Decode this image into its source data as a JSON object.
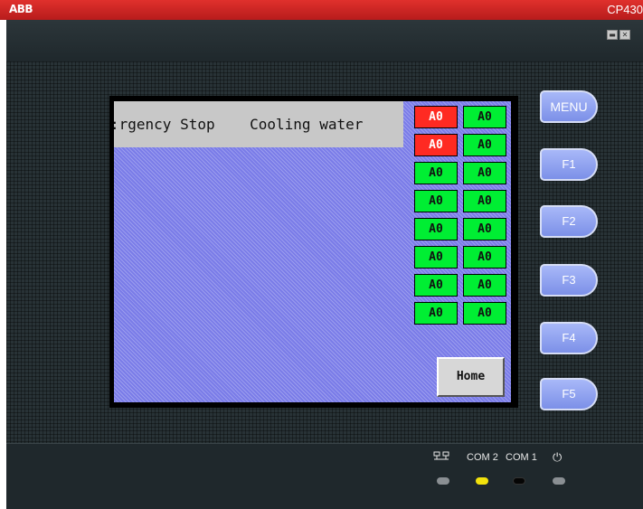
{
  "window": {
    "brand": "ABB",
    "model": "CP430",
    "minimize_symbol": "▬",
    "close_symbol": "✕"
  },
  "screen": {
    "alarm_banner": ":rgency Stop    Cooling water",
    "indicators": [
      {
        "label": "A0",
        "state": "alarm"
      },
      {
        "label": "A0",
        "state": "normal"
      },
      {
        "label": "A0",
        "state": "alarm"
      },
      {
        "label": "A0",
        "state": "normal"
      },
      {
        "label": "A0",
        "state": "normal"
      },
      {
        "label": "A0",
        "state": "normal"
      },
      {
        "label": "A0",
        "state": "normal"
      },
      {
        "label": "A0",
        "state": "normal"
      },
      {
        "label": "A0",
        "state": "normal"
      },
      {
        "label": "A0",
        "state": "normal"
      },
      {
        "label": "A0",
        "state": "normal"
      },
      {
        "label": "A0",
        "state": "normal"
      },
      {
        "label": "A0",
        "state": "normal"
      },
      {
        "label": "A0",
        "state": "normal"
      },
      {
        "label": "A0",
        "state": "normal"
      },
      {
        "label": "A0",
        "state": "normal"
      }
    ],
    "home_label": "Home"
  },
  "function_keys": {
    "menu": "MENU",
    "f1": "F1",
    "f2": "F2",
    "f3": "F3",
    "f4": "F4",
    "f5": "F5"
  },
  "status_panel": {
    "network_icon": "network-icon",
    "com2": "COM 2",
    "com1": "COM 1",
    "power_icon": "power-icon",
    "power_symbol": "⏻"
  },
  "colors": {
    "title_red": "#c62828",
    "indicator_alarm": "#ff2a22",
    "indicator_normal": "#00ee33",
    "screen_blue": "#7a7ce8",
    "led_com2": "#f2e20c",
    "led_off": "#8a8f93",
    "led_com1": "#050505"
  }
}
